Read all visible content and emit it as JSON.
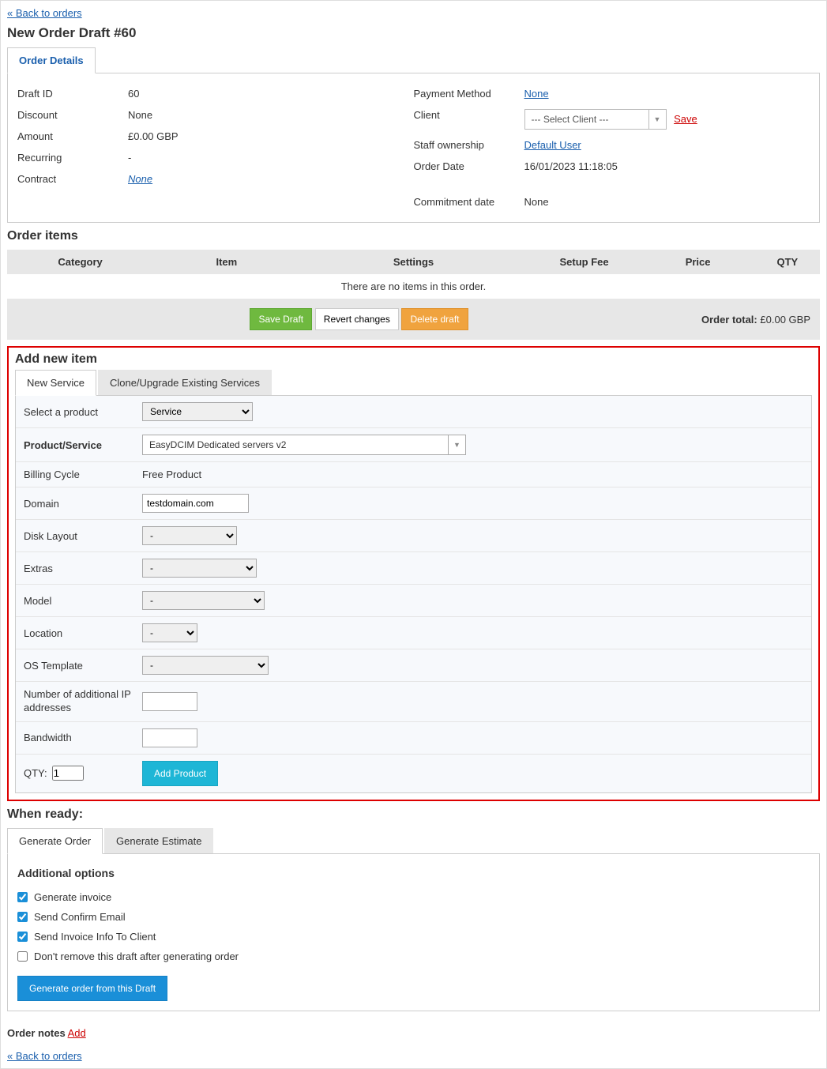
{
  "nav": {
    "back_link": "« Back to orders"
  },
  "header": {
    "title": "New Order Draft #60"
  },
  "tabs": {
    "order_details": "Order Details"
  },
  "details": {
    "left": {
      "draft_id_label": "Draft ID",
      "draft_id": "60",
      "discount_label": "Discount",
      "discount": "None",
      "amount_label": "Amount",
      "amount": "£0.00 GBP",
      "recurring_label": "Recurring",
      "recurring": "-",
      "contract_label": "Contract",
      "contract": "None"
    },
    "right": {
      "payment_method_label": "Payment Method",
      "payment_method": "None",
      "client_label": "Client",
      "client_placeholder": "--- Select Client ---",
      "save_link": "Save",
      "staff_label": "Staff ownership",
      "staff": "Default User",
      "order_date_label": "Order Date",
      "order_date": "16/01/2023 11:18:05",
      "commitment_label": "Commitment date",
      "commitment": "None"
    }
  },
  "order_items": {
    "heading": "Order items",
    "cols": {
      "category": "Category",
      "item": "Item",
      "settings": "Settings",
      "setup_fee": "Setup Fee",
      "price": "Price",
      "qty": "QTY"
    },
    "empty": "There are no items in this order.",
    "buttons": {
      "save_draft": "Save Draft",
      "revert": "Revert changes",
      "delete_draft": "Delete draft"
    },
    "total_label": "Order total:",
    "total_value": "£0.00 GBP"
  },
  "add_item": {
    "heading": "Add new item",
    "tabs": {
      "new_service": "New Service",
      "clone": "Clone/Upgrade Existing Services"
    },
    "rows": {
      "select_product_label": "Select a product",
      "select_product_value": "Service",
      "product_service_label": "Product/Service",
      "product_service_value": "EasyDCIM Dedicated servers v2",
      "billing_cycle_label": "Billing Cycle",
      "billing_cycle_value": "Free Product",
      "domain_label": "Domain",
      "domain_value": "testdomain.com",
      "disk_layout_label": "Disk Layout",
      "disk_layout_value": "-",
      "extras_label": "Extras",
      "extras_value": "-",
      "model_label": "Model",
      "model_value": "-",
      "location_label": "Location",
      "location_value": "-",
      "os_template_label": "OS Template",
      "os_template_value": "-",
      "ip_label": "Number of additional IP addresses",
      "bandwidth_label": "Bandwidth",
      "qty_label": "QTY:",
      "qty_value": "1",
      "add_product_btn": "Add Product"
    }
  },
  "when_ready": {
    "heading": "When ready:",
    "tabs": {
      "generate_order": "Generate Order",
      "generate_estimate": "Generate Estimate"
    },
    "additional_options": "Additional options",
    "opts": {
      "generate_invoice": "Generate invoice",
      "send_confirm": "Send Confirm Email",
      "send_invoice_info": "Send Invoice Info To Client",
      "dont_remove": "Don't remove this draft after generating order"
    },
    "generate_btn": "Generate order from this Draft"
  },
  "notes": {
    "label": "Order notes",
    "add": "Add"
  }
}
